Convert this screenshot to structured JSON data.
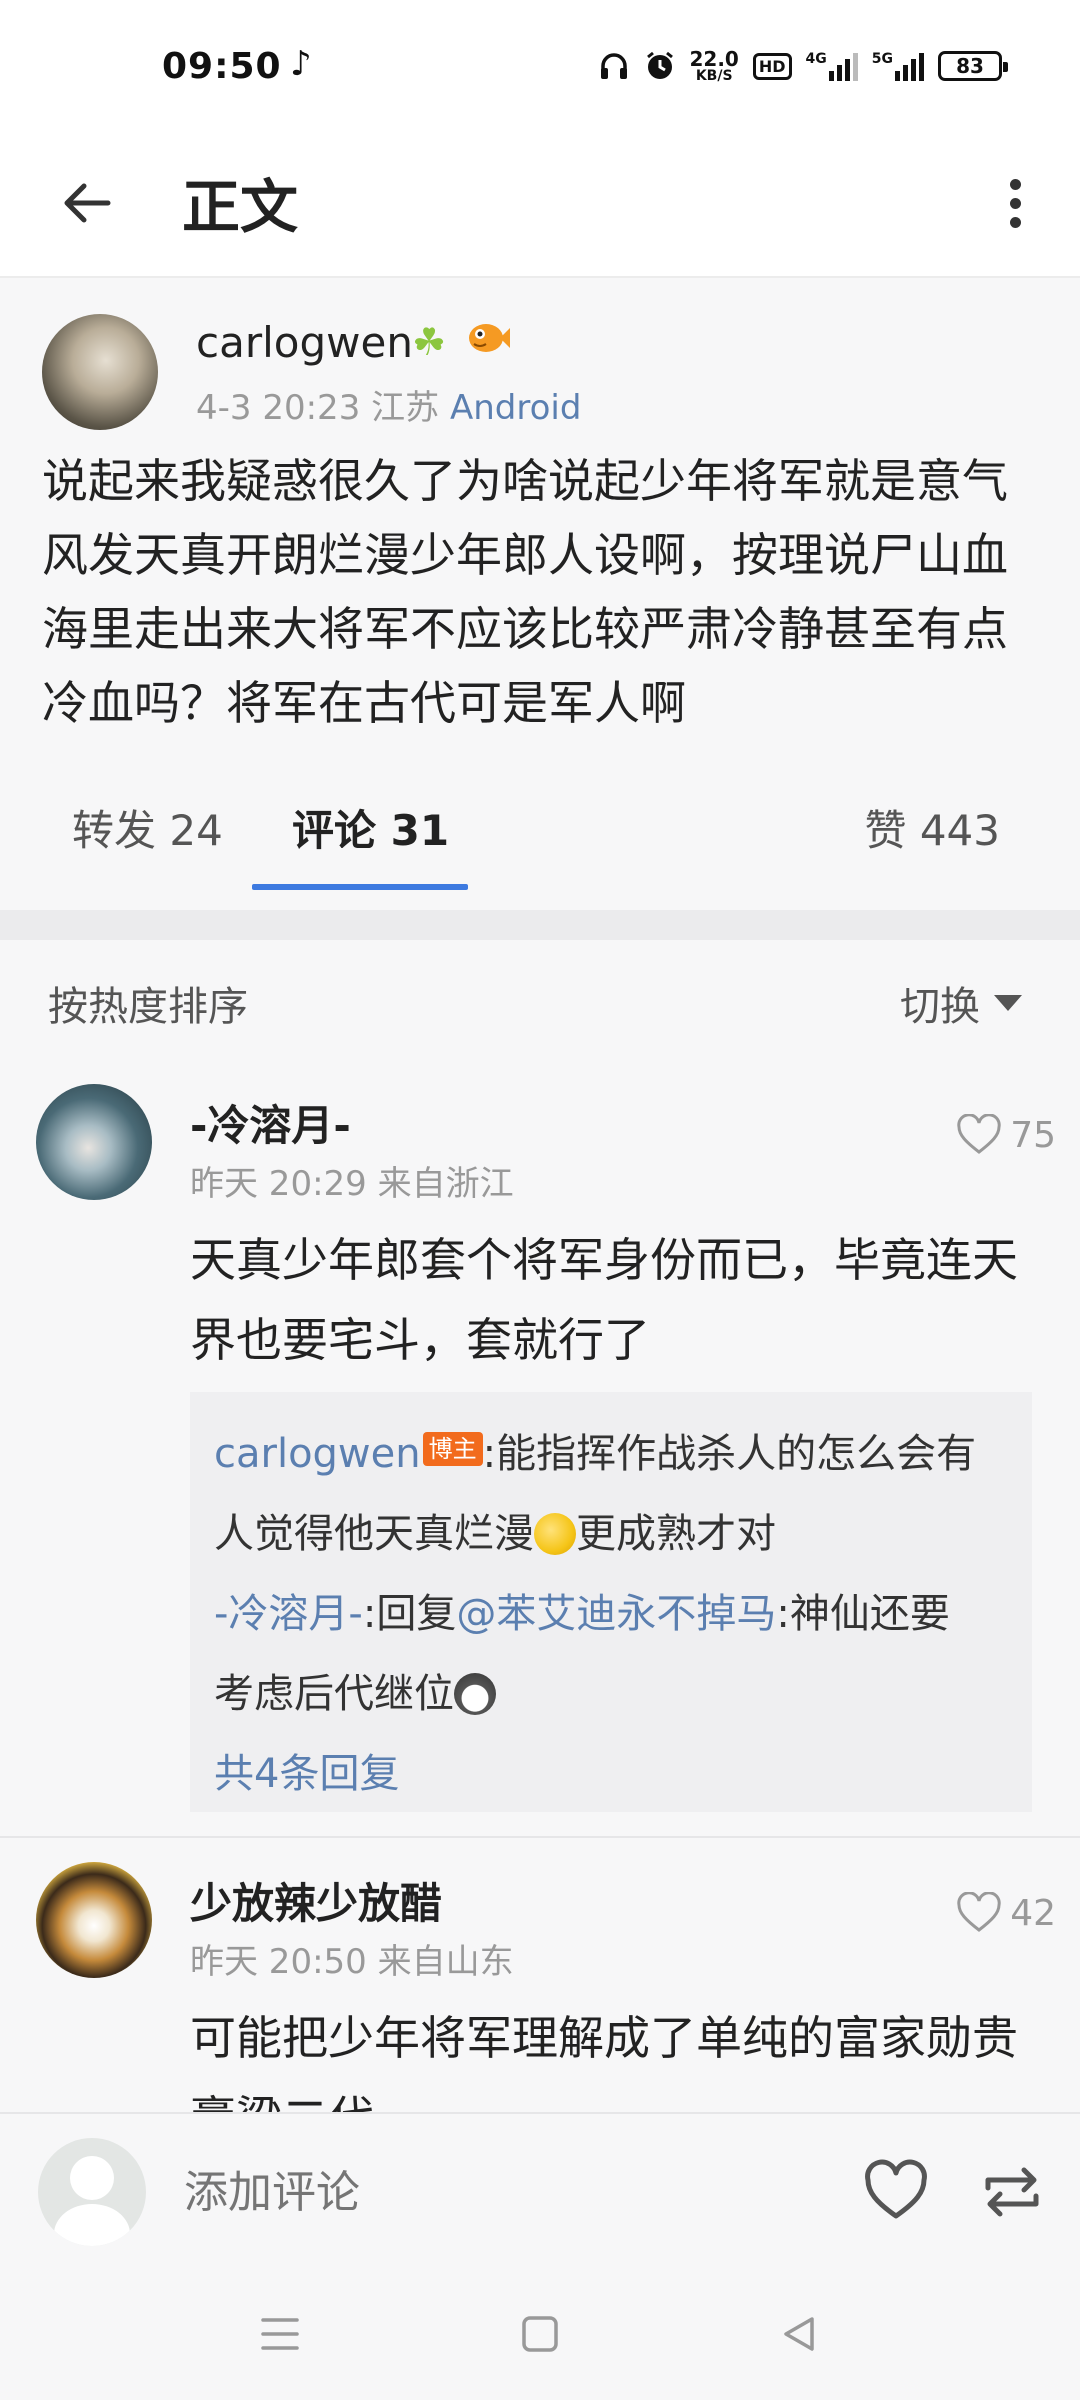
{
  "status_bar": {
    "time": "09:50",
    "music_icon": "music-note-icon",
    "speed_value": "22.0",
    "speed_unit": "KB/S",
    "hd_label": "HD",
    "net1_label": "4G",
    "net2_label": "5G",
    "battery": "83"
  },
  "header": {
    "title": "正文"
  },
  "post": {
    "author": "carlogwen",
    "time_location": "4-3 20:23 江苏",
    "platform": "Android",
    "text": "说起来我疑惑很久了为啥说起少年将军就是意气风发天真开朗烂漫少年郎人设啊，按理说尸山血海里走出来大将军不应该比较严肃冷静甚至有点冷血吗？将军在古代可是军人啊"
  },
  "tabs": {
    "forward": "转发 24",
    "comment": "评论 31",
    "like": "赞 443"
  },
  "comments_header": {
    "sort_label": "按热度排序",
    "switch_label": "切换"
  },
  "comments": [
    {
      "name": "-冷溶月-",
      "meta": "昨天 20:29 来自浙江",
      "likes": "75",
      "text": "天真少年郎套个将军身份而已，毕竟连天界也要宅斗，套就行了",
      "replies": {
        "r1_user": "carlogwen",
        "r1_badge": "博主",
        "r1_text_a": ":能指挥作战杀人的怎么会有",
        "r1_text_b": "人觉得他天真烂漫",
        "r1_text_c": "更成熟才对",
        "r2_user": "-冷溶月-",
        "r2_text_a": ":回复",
        "r2_mention": "@苯艾迪永不掉马",
        "r2_text_b": ":神仙还要",
        "r2_text_c": "考虑后代继位",
        "more": "共4条回复"
      }
    },
    {
      "name": "少放辣少放醋",
      "meta": "昨天 20:50 来自山东",
      "likes": "42",
      "text": "可能把少年将军理解成了单纯的富家勋贵膏粱二代"
    }
  ],
  "bottom_bar": {
    "placeholder": "添加评论"
  },
  "colors": {
    "accent": "#3d7ae0",
    "link": "#5b7fb0",
    "badge": "#f26b1d"
  }
}
